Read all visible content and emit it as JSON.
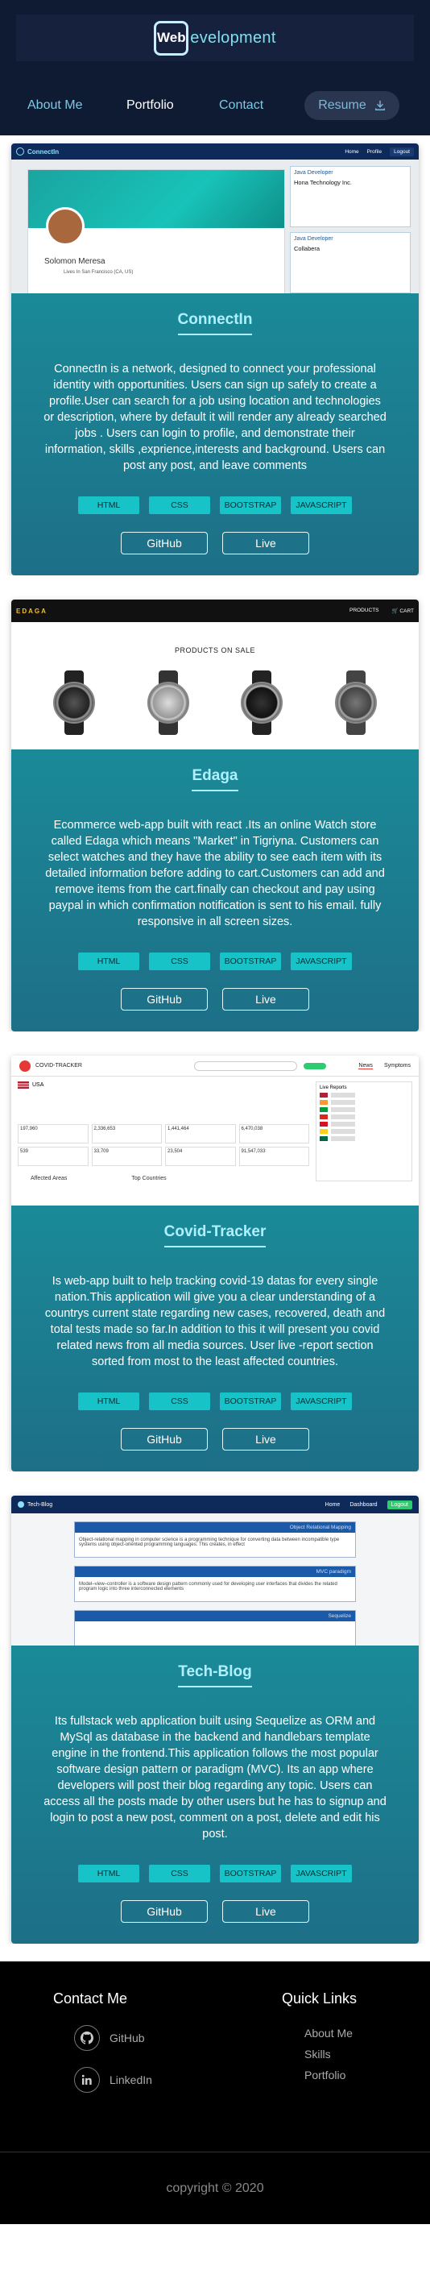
{
  "header": {
    "logo_mark": "Web",
    "logo_rest": "evelopment",
    "nav": {
      "about": "About Me",
      "portfolio": "Portfolio",
      "contact": "Contact",
      "resume": "Resume"
    }
  },
  "projects": [
    {
      "title": "ConnectIn",
      "description": "ConnectIn is a network, designed to connect your professional identity with opportunities. Users can sign up safely to create a profile.User can search for a job using location and technologies or description, where by default it will render any already searched jobs . Users can login to profile, and demonstrate their information, skills ,exprience,interests and background. Users can post any post, and leave comments",
      "tags": [
        "HTML",
        "CSS",
        "BOOTSTRAP",
        "JAVASCRIPT"
      ],
      "github": "GitHub",
      "live": "Live",
      "shot": {
        "brand": "ConnectIn",
        "nav_home": "Home",
        "nav_profile": "Profile",
        "nav_logout": "Logout",
        "profile_name": "Solomon Meresa",
        "profile_location": "Lives In San Francisco (CA, US)",
        "job1_title": "Java Developer",
        "job1_company": "Hona Technology Inc.",
        "job2_title": "Java Developer",
        "job2_company": "Collabera"
      }
    },
    {
      "title": "Edaga",
      "description": "Ecommerce web-app built with react .Its an online Watch store called Edaga which means \"Market\" in Tigriyna. Customers can select watches and they have the ability to see each item with its detailed information before adding to cart.Customers can add and remove items from the cart.finally can checkout and pay using paypal in which confirmation notification is sent to his email. fully responsive in all screen sizes.",
      "tags": [
        "HTML",
        "CSS",
        "BOOTSTRAP",
        "JAVASCRIPT"
      ],
      "github": "GitHub",
      "live": "Live",
      "shot": {
        "brand": "EDAGA",
        "nav_products": "PRODUCTS",
        "nav_cart": "CART",
        "heading": "PRODUCTS ON SALE"
      }
    },
    {
      "title": "Covid-Tracker",
      "description": "Is web-app built to help tracking covid-19 datas for every single nation.This application will give you a clear understanding of a countrys current state regarding new cases, recovered, death and total tests made so far.In addition to this it will present you covid related news from all media sources. User live -report section sorted from most to the least affected countries.",
      "tags": [
        "HTML",
        "CSS",
        "BOOTSTRAP",
        "JAVASCRIPT"
      ],
      "github": "GitHub",
      "live": "Live",
      "shot": {
        "brand": "COVID-TRACKER",
        "nav_news": "News",
        "nav_symptoms": "Symptoms",
        "country": "USA",
        "live_reports": "Live Reports",
        "affected_areas": "Affected Areas",
        "top_countries": "Top Countries",
        "stats": [
          "197,960",
          "2,336,653",
          "1,441,464",
          "6,470,038",
          "539",
          "33,709",
          "23,504",
          "91,547,033"
        ]
      }
    },
    {
      "title": "Tech-Blog",
      "description": "Its fullstack web application built using Sequelize as ORM and MySql as database in the backend and handlebars template engine in the frontend.This application follows the most popular software design pattern or paradigm (MVC). Its an app where developers will post their blog regarding any topic. Users can access all the posts made by other users but he has to signup and login to post a new post, comment on a post, delete and edit his post.",
      "tags": [
        "HTML",
        "CSS",
        "BOOTSTRAP",
        "JAVASCRIPT"
      ],
      "github": "GitHub",
      "live": "Live",
      "shot": {
        "brand": "Tech-Blog",
        "nav_home": "Home",
        "nav_dashboard": "Dashboard",
        "nav_logout": "Logout",
        "post1_title": "Object Relational Mapping",
        "post1_body": "Object-relational mapping in computer science is a programming technique for converting data between incompatible type systems using object-oriented programming languages. This creates, in effect",
        "post2_title": "MVC paradigm",
        "post2_body": "Model–view–controller is a software design pattern commonly used for developing user interfaces that divides the related program logic into three interconnected elements",
        "post3_title": "Sequelize"
      }
    }
  ],
  "footer": {
    "contact_heading": "Contact Me",
    "github": "GitHub",
    "linkedin": "LinkedIn",
    "links_heading": "Quick Links",
    "link_about": "About Me",
    "link_skills": "Skills",
    "link_portfolio": "Portfolio",
    "copyright": "copyright © 2020"
  },
  "colors": {
    "header_bg": "#0f1a33",
    "card_gradient_top": "#1a8a98",
    "card_gradient_bottom": "#1d6f88",
    "tag_bg": "#18c3c8",
    "title_color": "#aef0ff",
    "footer_bg": "#000000"
  }
}
